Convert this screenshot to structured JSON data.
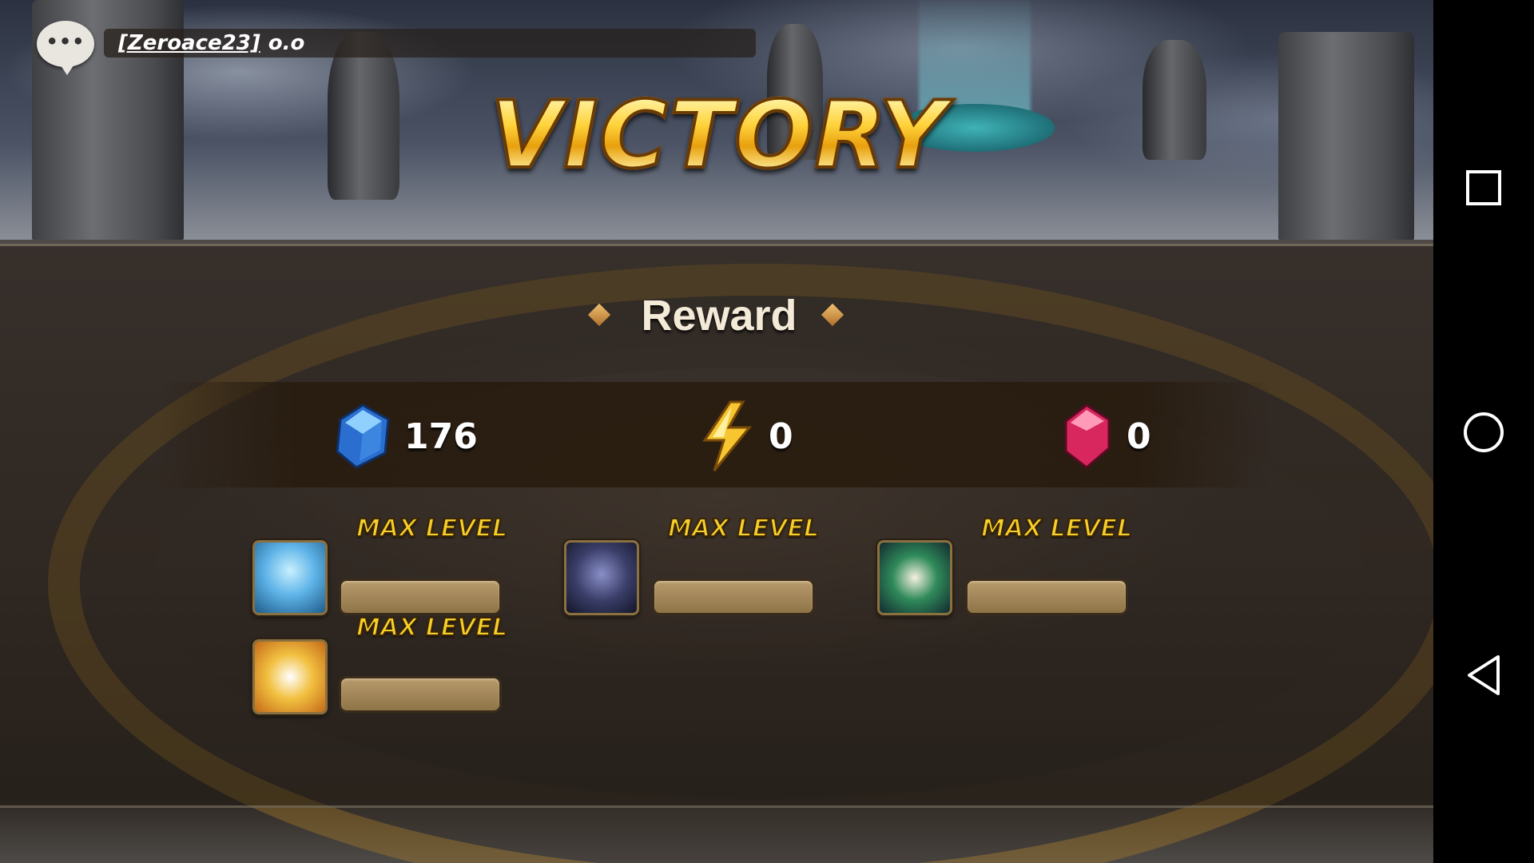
{
  "chat": {
    "user": "[Zeroace23]",
    "message": "o.o",
    "icon": "chat-bubble-icon"
  },
  "result": {
    "title": "VICTORY"
  },
  "reward": {
    "title": "Reward",
    "items": [
      {
        "icon": "crystal-icon",
        "value": "176",
        "color": "#3a8fe0"
      },
      {
        "icon": "energy-icon",
        "value": "0",
        "color": "#f2c430"
      },
      {
        "icon": "rune-gem-icon",
        "value": "0",
        "color": "#e03a70"
      }
    ]
  },
  "monsters": [
    {
      "status": "MAX LEVEL",
      "portrait": "water-horned-monster-portrait",
      "color": "#5fb4e8"
    },
    {
      "status": "MAX LEVEL",
      "portrait": "dark-horned-monster-portrait",
      "color": "#3b3f6a"
    },
    {
      "status": "MAX LEVEL",
      "portrait": "griffon-monster-portrait",
      "color": "#2f8a5a"
    },
    {
      "status": "MAX LEVEL",
      "portrait": "fire-beast-monster-portrait",
      "color": "#f2c040"
    }
  ],
  "navbar": {
    "recent": "recent-apps-icon",
    "home": "home-icon",
    "back": "back-icon"
  }
}
